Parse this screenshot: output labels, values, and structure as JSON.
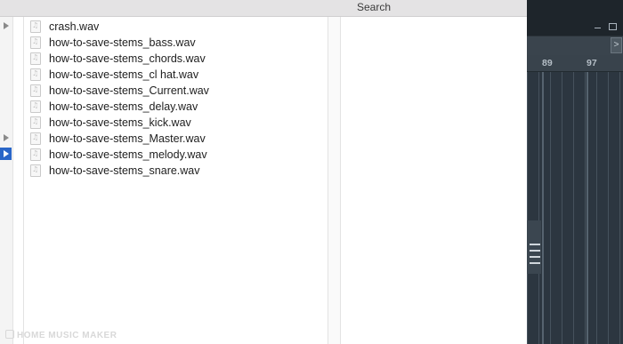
{
  "window": {
    "title": "Search"
  },
  "files": [
    {
      "name": "crash.wav",
      "icon": "audio-file-icon"
    },
    {
      "name": "how-to-save-stems_bass.wav",
      "icon": "audio-file-icon"
    },
    {
      "name": "how-to-save-stems_chords.wav",
      "icon": "audio-file-icon"
    },
    {
      "name": "how-to-save-stems_cl hat.wav",
      "icon": "audio-file-icon"
    },
    {
      "name": "how-to-save-stems_Current.wav",
      "icon": "audio-file-icon"
    },
    {
      "name": "how-to-save-stems_delay.wav",
      "icon": "audio-file-icon"
    },
    {
      "name": "how-to-save-stems_kick.wav",
      "icon": "audio-file-icon"
    },
    {
      "name": "how-to-save-stems_Master.wav",
      "icon": "audio-file-icon"
    },
    {
      "name": "how-to-save-stems_melody.wav",
      "icon": "audio-file-icon"
    },
    {
      "name": "how-to-save-stems_snare.wav",
      "icon": "audio-file-icon"
    }
  ],
  "daw": {
    "ruler": [
      "89",
      "97"
    ],
    "scroll_button": ">"
  },
  "watermark": "HOME MUSIC MAKER",
  "colors": {
    "selection": "#2a66c8",
    "daw_background": "#2d3740",
    "title_bar": "#e4e3e4"
  }
}
